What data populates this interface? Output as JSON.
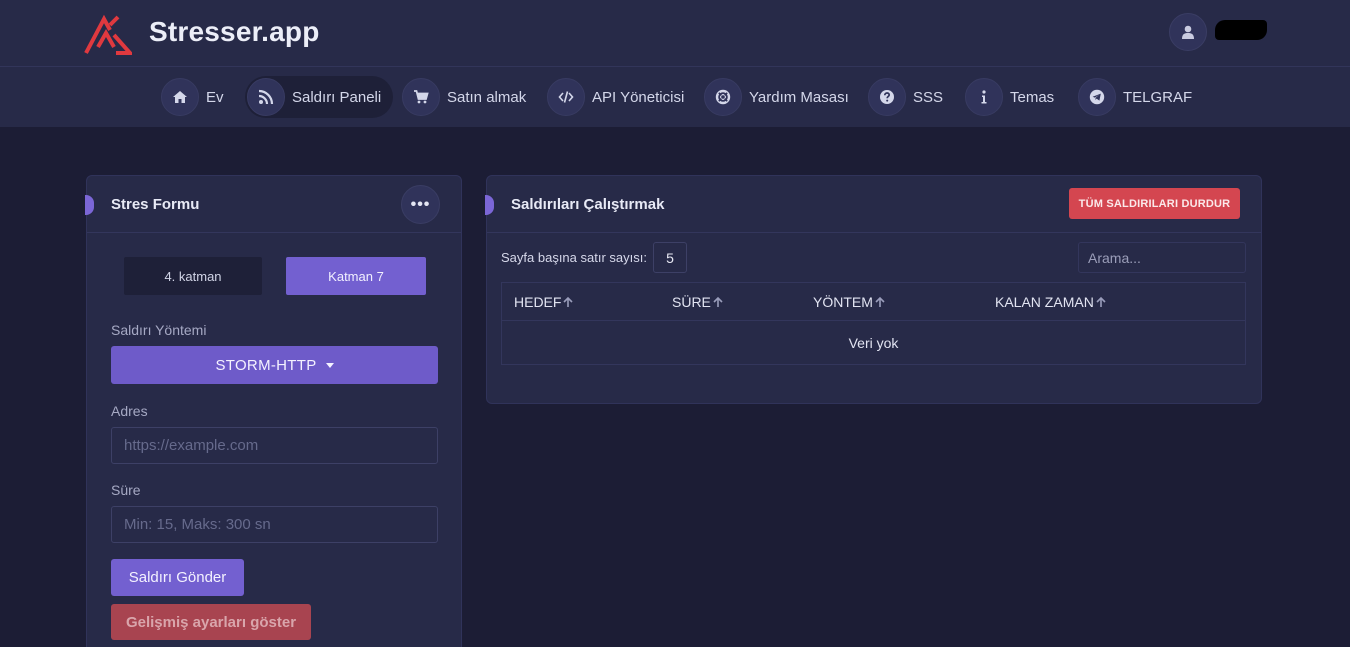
{
  "header": {
    "brand": "Stresser.app",
    "user_icon": "user-icon"
  },
  "nav": {
    "items": [
      {
        "label": "Ev",
        "icon": "home-icon"
      },
      {
        "label": "Saldırı Paneli",
        "icon": "rss-icon",
        "active": true
      },
      {
        "label": "Satın almak",
        "icon": "cart-icon"
      },
      {
        "label": "API Yöneticisi",
        "icon": "code-icon"
      },
      {
        "label": "Yardım Masası",
        "icon": "lifebuoy-icon"
      },
      {
        "label": "SSS",
        "icon": "question-icon"
      },
      {
        "label": "Temas",
        "icon": "info-icon"
      },
      {
        "label": "TELGRAF",
        "icon": "telegram-icon"
      }
    ]
  },
  "stress_form": {
    "title": "Stres Formu",
    "menu_icon": "more-dots-icon",
    "layer4_label": "4. katman",
    "layer7_label": "Katman 7",
    "method_label": "Saldırı Yöntemi",
    "method_value": "STORM-HTTP",
    "address_label": "Adres",
    "address_placeholder": "https://example.com",
    "duration_label": "Süre",
    "duration_placeholder": "Min: 15, Maks: 300 sn",
    "submit_label": "Saldırı Gönder",
    "advanced_label": "Gelişmiş ayarları göster"
  },
  "attacks": {
    "title": "Saldırıları Çalıştırmak",
    "stop_all_label": "TÜM SALDIRILARI DURDUR",
    "rows_per_page_label": "Sayfa başına satır sayısı:",
    "rows_per_page_value": "5",
    "search_placeholder": "Arama...",
    "columns": [
      "HEDEF",
      "SÜRE",
      "YÖNTEM",
      "KALAN ZAMAN"
    ],
    "empty_text": "Veri yok"
  },
  "colors": {
    "accent": "#7360d0",
    "danger": "#d44650",
    "background": "#1c1d35",
    "panel": "#272a48"
  }
}
